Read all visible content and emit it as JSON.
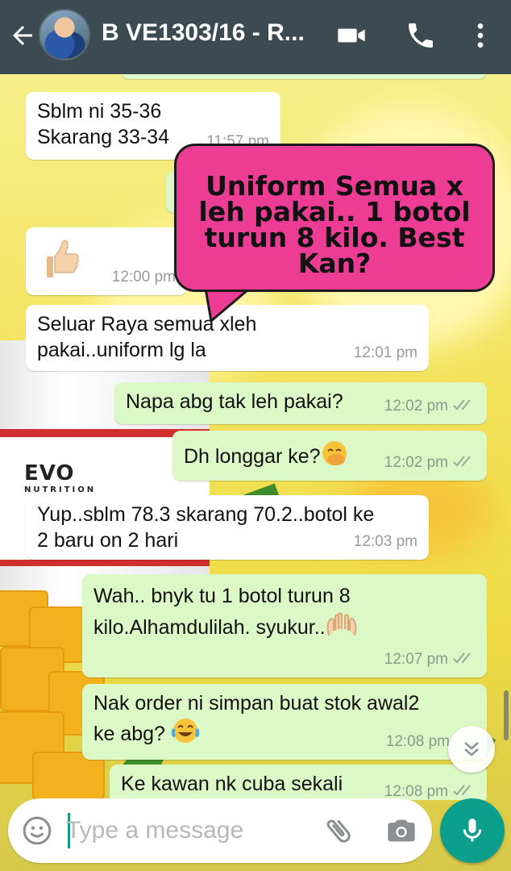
{
  "header": {
    "title": "B VE1303/16 - R...",
    "icons": [
      "back-arrow-icon",
      "video-call-icon",
      "phone-icon",
      "more-vert-icon"
    ]
  },
  "messages": [
    {
      "dir": "in",
      "lines": "Sblm ni 35-36\nSkarang 33-34",
      "time": "11:57 pm"
    },
    {
      "dir": "in",
      "lines": "",
      "emoji": "thumbs-up",
      "time": "12:00 pm"
    },
    {
      "dir": "in",
      "lines": "Seluar Raya semua xleh\npakai..uniform lg la",
      "time": "12:01 pm"
    },
    {
      "dir": "out",
      "lines": "Napa abg tak leh pakai?",
      "time": "12:02 pm"
    },
    {
      "dir": "out",
      "lines": "Dh longgar ke?",
      "emoji": "face-hand-over-mouth",
      "time": "12:02 pm"
    },
    {
      "dir": "in",
      "lines": "Yup..sblm 78.3 skarang 70.2..botol ke\n2 baru on 2 hari",
      "time": "12:03 pm"
    },
    {
      "dir": "out",
      "lines": "Wah.. bnyk tu 1 botol turun 8\nkilo.Alhamdulilah. syukur..",
      "emoji": "palms-up",
      "time": "12:07 pm"
    },
    {
      "dir": "out",
      "lines": "Nak order ni simpan buat stok awal2\nke abg? ",
      "emoji": "tears-of-joy",
      "time": "12:08 pm"
    },
    {
      "dir": "out",
      "lines": "Ke kawan nk cuba sekali",
      "time": "12:08 pm"
    }
  ],
  "callout": {
    "text": "Uniform Semua x leh pakai.. 1 botol turun 8 kilo. Best Kan?"
  },
  "wallpaper": {
    "brand": "EVO",
    "brand_sub": "NUTRITION"
  },
  "input": {
    "placeholder": "Type a message"
  },
  "colors": {
    "header": "#3b4b51",
    "outgoing": "#dcf8c6",
    "incoming": "#ffffff",
    "accent": "#0b9e8c",
    "callout": "#ec3c93"
  }
}
